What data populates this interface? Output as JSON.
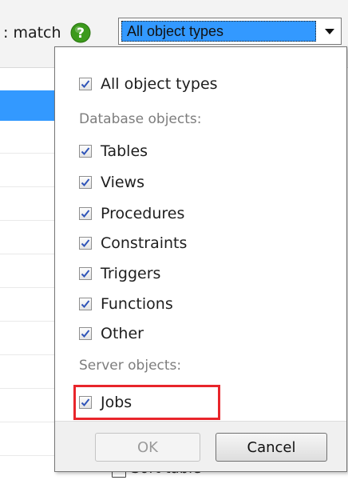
{
  "toolbar": {
    "match_label": ": match",
    "object_type_select": {
      "value": "All object types"
    }
  },
  "background": {
    "bottom_item_label": "Sort table"
  },
  "dropdown": {
    "all_option": {
      "label": "All object types",
      "checked": true
    },
    "database_group_label": "Database objects:",
    "database_options": [
      {
        "label": "Tables",
        "checked": true
      },
      {
        "label": "Views",
        "checked": true
      },
      {
        "label": "Procedures",
        "checked": true
      },
      {
        "label": "Constraints",
        "checked": true
      },
      {
        "label": "Triggers",
        "checked": true
      },
      {
        "label": "Functions",
        "checked": true
      },
      {
        "label": "Other",
        "checked": true
      }
    ],
    "server_group_label": "Server objects:",
    "server_options": [
      {
        "label": "Jobs",
        "checked": true
      }
    ],
    "ok_label": "OK",
    "cancel_label": "Cancel"
  },
  "colors": {
    "selection_blue": "#3399ff",
    "help_green": "#3c9a1c",
    "highlight_red": "#e8252b",
    "checkmark_blue": "#2f54b8"
  }
}
